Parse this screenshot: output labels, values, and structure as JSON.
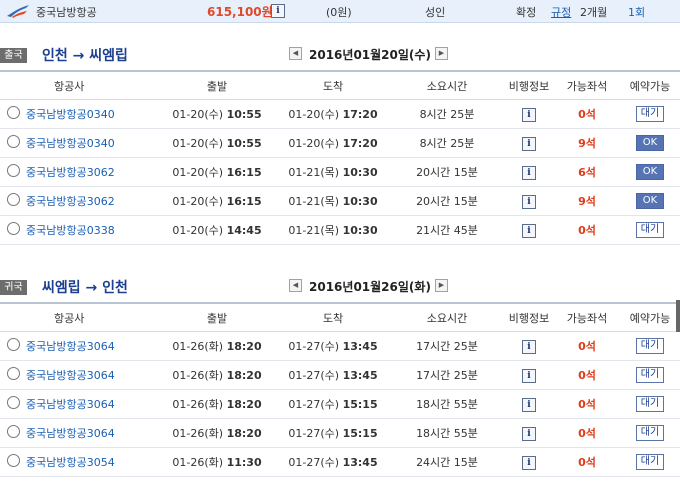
{
  "topbar": {
    "airline": "중국남방항공",
    "price": "615,100원",
    "extra": "(0원)",
    "passenger": "성인",
    "confirm_label": "확정",
    "rule_link": "규정",
    "duration": "2개월",
    "times": "1회"
  },
  "outbound": {
    "badge": "출국",
    "route": "인천 → 씨엠립",
    "date": "2016년01월20일(수)",
    "headers": [
      "항공사",
      "출발",
      "도착",
      "소요시간",
      "비행정보",
      "가능좌석",
      "예약가능"
    ],
    "rows": [
      {
        "airline": "중국남방항공0340",
        "dep_date": "01-20(수)",
        "dep_time": "10:55",
        "arr_date": "01-20(수)",
        "arr_time": "17:20",
        "duration": "8시간 25분",
        "seats": "0석",
        "status": "대기"
      },
      {
        "airline": "중국남방항공0340",
        "dep_date": "01-20(수)",
        "dep_time": "10:55",
        "arr_date": "01-20(수)",
        "arr_time": "17:20",
        "duration": "8시간 25분",
        "seats": "9석",
        "status": "OK"
      },
      {
        "airline": "중국남방항공3062",
        "dep_date": "01-20(수)",
        "dep_time": "16:15",
        "arr_date": "01-21(목)",
        "arr_time": "10:30",
        "duration": "20시간 15분",
        "seats": "6석",
        "status": "OK"
      },
      {
        "airline": "중국남방항공3062",
        "dep_date": "01-20(수)",
        "dep_time": "16:15",
        "arr_date": "01-21(목)",
        "arr_time": "10:30",
        "duration": "20시간 15분",
        "seats": "9석",
        "status": "OK"
      },
      {
        "airline": "중국남방항공0338",
        "dep_date": "01-20(수)",
        "dep_time": "14:45",
        "arr_date": "01-21(목)",
        "arr_time": "10:30",
        "duration": "21시간 45분",
        "seats": "0석",
        "status": "대기"
      }
    ]
  },
  "inbound": {
    "badge": "귀국",
    "route": "씨엠립 → 인천",
    "date": "2016년01월26일(화)",
    "headers": [
      "항공사",
      "출발",
      "도착",
      "소요시간",
      "비행정보",
      "가능좌석",
      "예약가능"
    ],
    "rows": [
      {
        "airline": "중국남방항공3064",
        "dep_date": "01-26(화)",
        "dep_time": "18:20",
        "arr_date": "01-27(수)",
        "arr_time": "13:45",
        "duration": "17시간 25분",
        "seats": "0석",
        "status": "대기"
      },
      {
        "airline": "중국남방항공3064",
        "dep_date": "01-26(화)",
        "dep_time": "18:20",
        "arr_date": "01-27(수)",
        "arr_time": "13:45",
        "duration": "17시간 25분",
        "seats": "0석",
        "status": "대기"
      },
      {
        "airline": "중국남방항공3064",
        "dep_date": "01-26(화)",
        "dep_time": "18:20",
        "arr_date": "01-27(수)",
        "arr_time": "15:15",
        "duration": "18시간 55분",
        "seats": "0석",
        "status": "대기"
      },
      {
        "airline": "중국남방항공3064",
        "dep_date": "01-26(화)",
        "dep_time": "18:20",
        "arr_date": "01-27(수)",
        "arr_time": "15:15",
        "duration": "18시간 55분",
        "seats": "0석",
        "status": "대기"
      },
      {
        "airline": "중국남방항공3054",
        "dep_date": "01-26(화)",
        "dep_time": "11:30",
        "arr_date": "01-27(수)",
        "arr_time": "13:45",
        "duration": "24시간 15분",
        "seats": "0석",
        "status": "대기"
      }
    ]
  },
  "icons": {
    "info": "info-icon",
    "prev": "arrow-left-icon",
    "next": "arrow-right-icon",
    "logo": "airline-logo-icon"
  },
  "colors": {
    "accent": "#1c3f8f",
    "price": "#e0492a",
    "seats": "#e03a16",
    "ok_button": "#5674b4",
    "badge": "#6d6d6d"
  }
}
